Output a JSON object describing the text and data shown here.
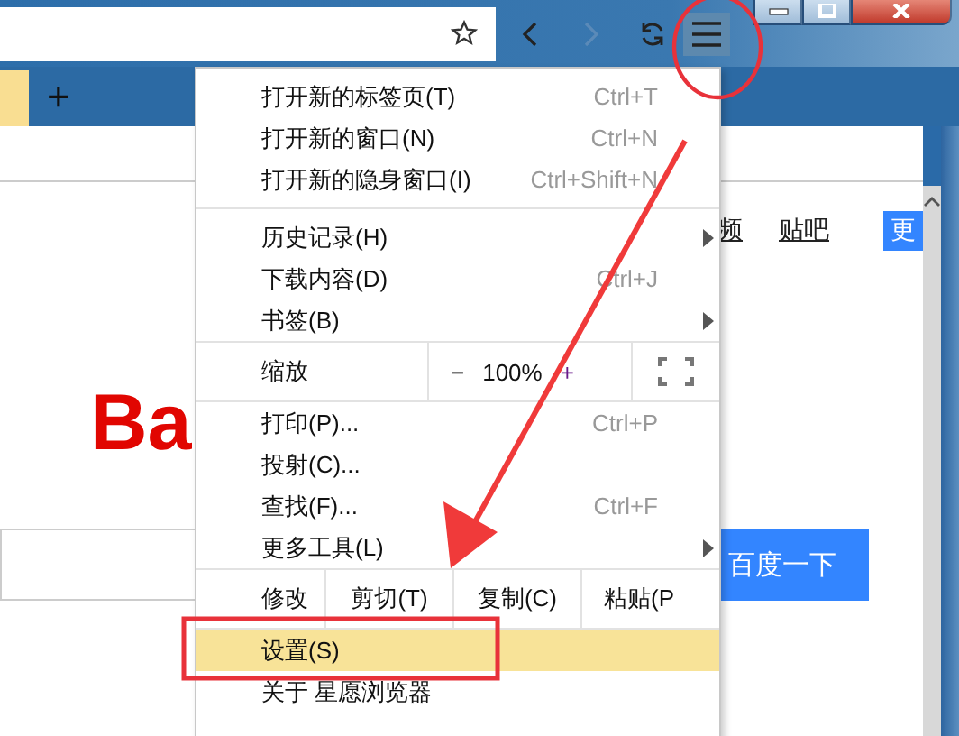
{
  "window": {
    "controls": [
      {
        "kind": "minimize"
      },
      {
        "kind": "maximize"
      },
      {
        "kind": "close"
      }
    ]
  },
  "toolbar": {
    "buttons": [
      {
        "kind": "back",
        "disabled": false
      },
      {
        "kind": "forward",
        "disabled": true
      },
      {
        "kind": "reload",
        "disabled": false
      },
      {
        "kind": "menu",
        "disabled": false,
        "active": true
      }
    ]
  },
  "tabs": [
    {
      "selected": true
    }
  ],
  "new_tab": "+",
  "page": {
    "links": [
      "频",
      "贴吧"
    ],
    "top_button": "更",
    "logo": "Ba",
    "search_button": "百度一下"
  },
  "menu": {
    "items": [
      {
        "kind": "item",
        "label": "打开新的标签页(T)",
        "shortcut": "Ctrl+T",
        "submenu": false,
        "selected": false
      },
      {
        "kind": "item",
        "label": "打开新的窗口(N)",
        "shortcut": "Ctrl+N",
        "submenu": false,
        "selected": false
      },
      {
        "kind": "item",
        "label": "打开新的隐身窗口(I)",
        "shortcut": "Ctrl+Shift+N",
        "submenu": false,
        "selected": false
      },
      {
        "kind": "separator"
      },
      {
        "kind": "item",
        "label": "历史记录(H)",
        "submenu": true,
        "selected": false
      },
      {
        "kind": "item",
        "label": "下载内容(D)",
        "shortcut": "Ctrl+J",
        "submenu": false,
        "selected": false
      },
      {
        "kind": "item",
        "label": "书签(B)",
        "submenu": true,
        "selected": false
      },
      {
        "kind": "zoom",
        "label": "缩放",
        "minus": "−",
        "value": "100%",
        "plus": "+"
      },
      {
        "kind": "item",
        "label": "打印(P)...",
        "shortcut": "Ctrl+P",
        "submenu": false,
        "selected": false
      },
      {
        "kind": "item",
        "label": "投射(C)...",
        "submenu": false,
        "selected": false
      },
      {
        "kind": "item",
        "label": "查找(F)...",
        "shortcut": "Ctrl+F",
        "submenu": false,
        "selected": false
      },
      {
        "kind": "item",
        "label": "更多工具(L)",
        "submenu": true,
        "selected": false
      },
      {
        "kind": "edit",
        "label": "修改",
        "actions": [
          "剪切(T)",
          "复制(C)",
          "粘贴(P"
        ]
      },
      {
        "kind": "item",
        "label": "设置(S)",
        "submenu": false,
        "selected": true
      },
      {
        "kind": "item",
        "label": "关于 星愿浏览器",
        "submenu": false,
        "selected": false
      }
    ]
  },
  "annotations": [
    {
      "kind": "ellipse"
    },
    {
      "kind": "arrow"
    },
    {
      "kind": "frame"
    }
  ]
}
